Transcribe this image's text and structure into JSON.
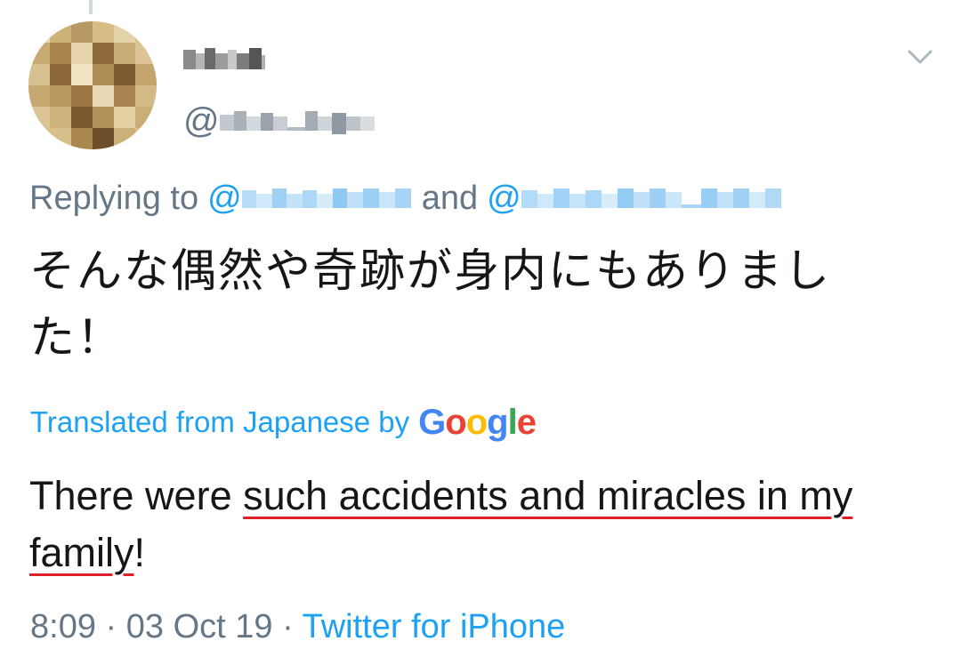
{
  "author": {
    "handle_prefix": "@"
  },
  "reply": {
    "label": "Replying to",
    "at_1": "@",
    "and_label": "and",
    "at_2": "@"
  },
  "tweet": {
    "text_ja": "そんな偶然や奇跡が身内にもありました！",
    "translated_label": "Translated from Japanese by",
    "google_g1": "G",
    "google_o1": "o",
    "google_o2": "o",
    "google_g2": "g",
    "google_l": "l",
    "google_e": "e",
    "text_en_before": "There were ",
    "text_en_underlined": "such accidents and miracles in my family",
    "text_en_after": "!"
  },
  "meta": {
    "time": "8:09",
    "separator_1": " · ",
    "date": "03 Oct 19",
    "separator_2": " · ",
    "source": "Twitter for iPhone"
  },
  "colors": {
    "link_blue": "#1da1f2",
    "muted_gray": "#657786",
    "text_dark": "#14171a",
    "underline_red": "#e0202a"
  },
  "icons": {
    "menu": "chevron-down-icon"
  }
}
